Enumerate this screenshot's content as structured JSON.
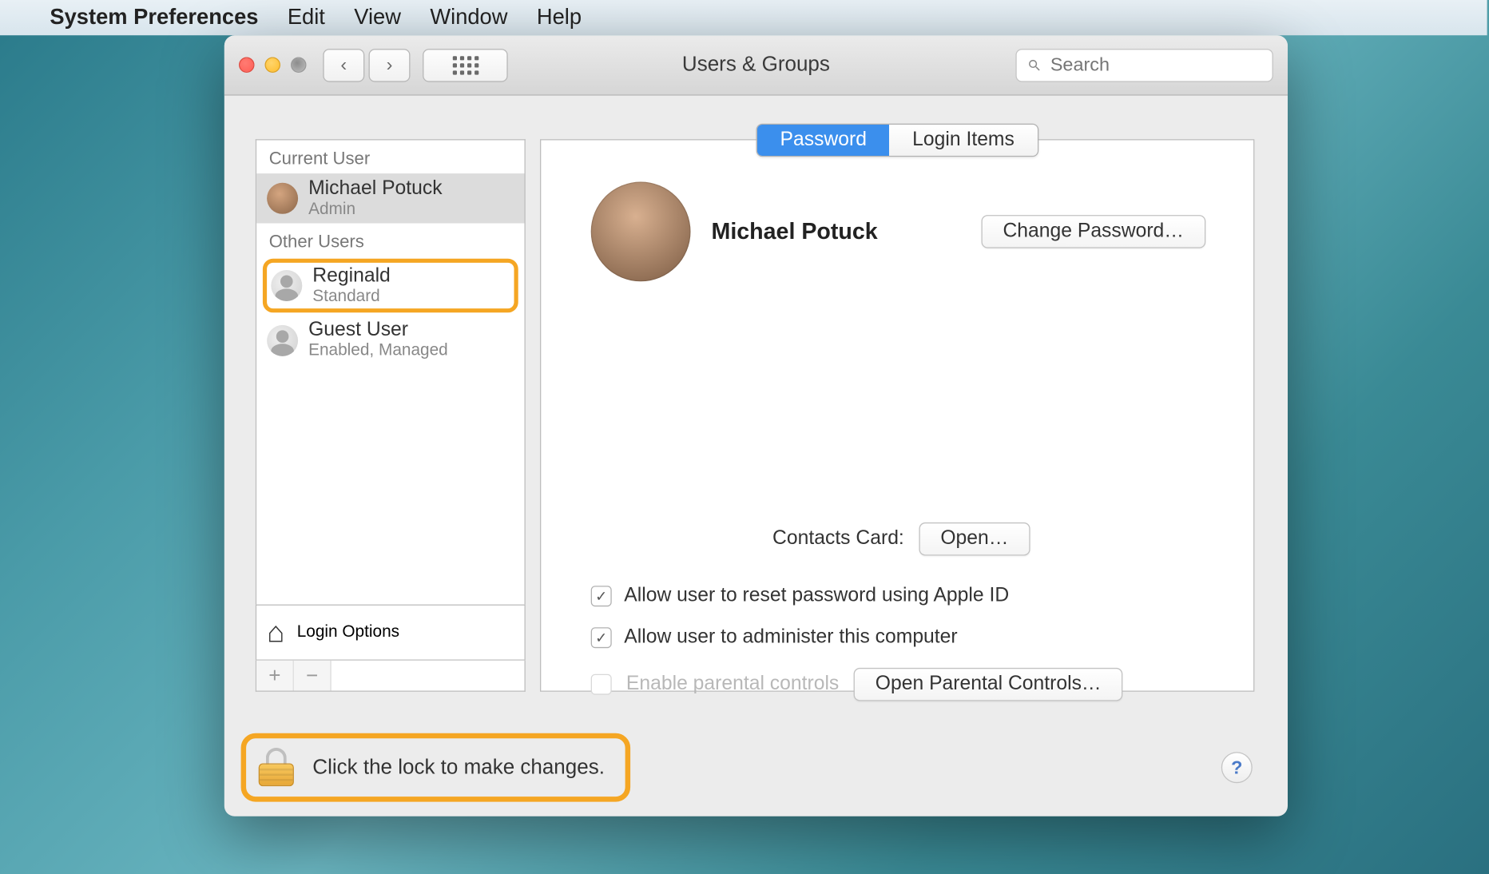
{
  "menubar": {
    "app_name": "System Preferences",
    "items": [
      "Edit",
      "View",
      "Window",
      "Help"
    ]
  },
  "window": {
    "title": "Users & Groups",
    "search_placeholder": "Search",
    "nav_back": "‹",
    "nav_forward": "›"
  },
  "sidebar": {
    "section_current": "Current User",
    "section_other": "Other Users",
    "users": [
      {
        "name": "Michael Potuck",
        "role": "Admin"
      },
      {
        "name": "Reginald",
        "role": "Standard"
      },
      {
        "name": "Guest User",
        "role": "Enabled, Managed"
      }
    ],
    "login_options": "Login Options",
    "add_label": "+",
    "remove_label": "−"
  },
  "tabs": {
    "password": "Password",
    "login_items": "Login Items"
  },
  "main": {
    "user_name": "Michael Potuck",
    "change_password": "Change Password…",
    "contacts_label": "Contacts Card:",
    "open_btn": "Open…",
    "check_reset": "Allow user to reset password using Apple ID",
    "check_admin": "Allow user to administer this computer",
    "check_parental": "Enable parental controls",
    "open_parental": "Open Parental Controls…"
  },
  "footer": {
    "lock_text": "Click the lock to make changes.",
    "help": "?"
  }
}
